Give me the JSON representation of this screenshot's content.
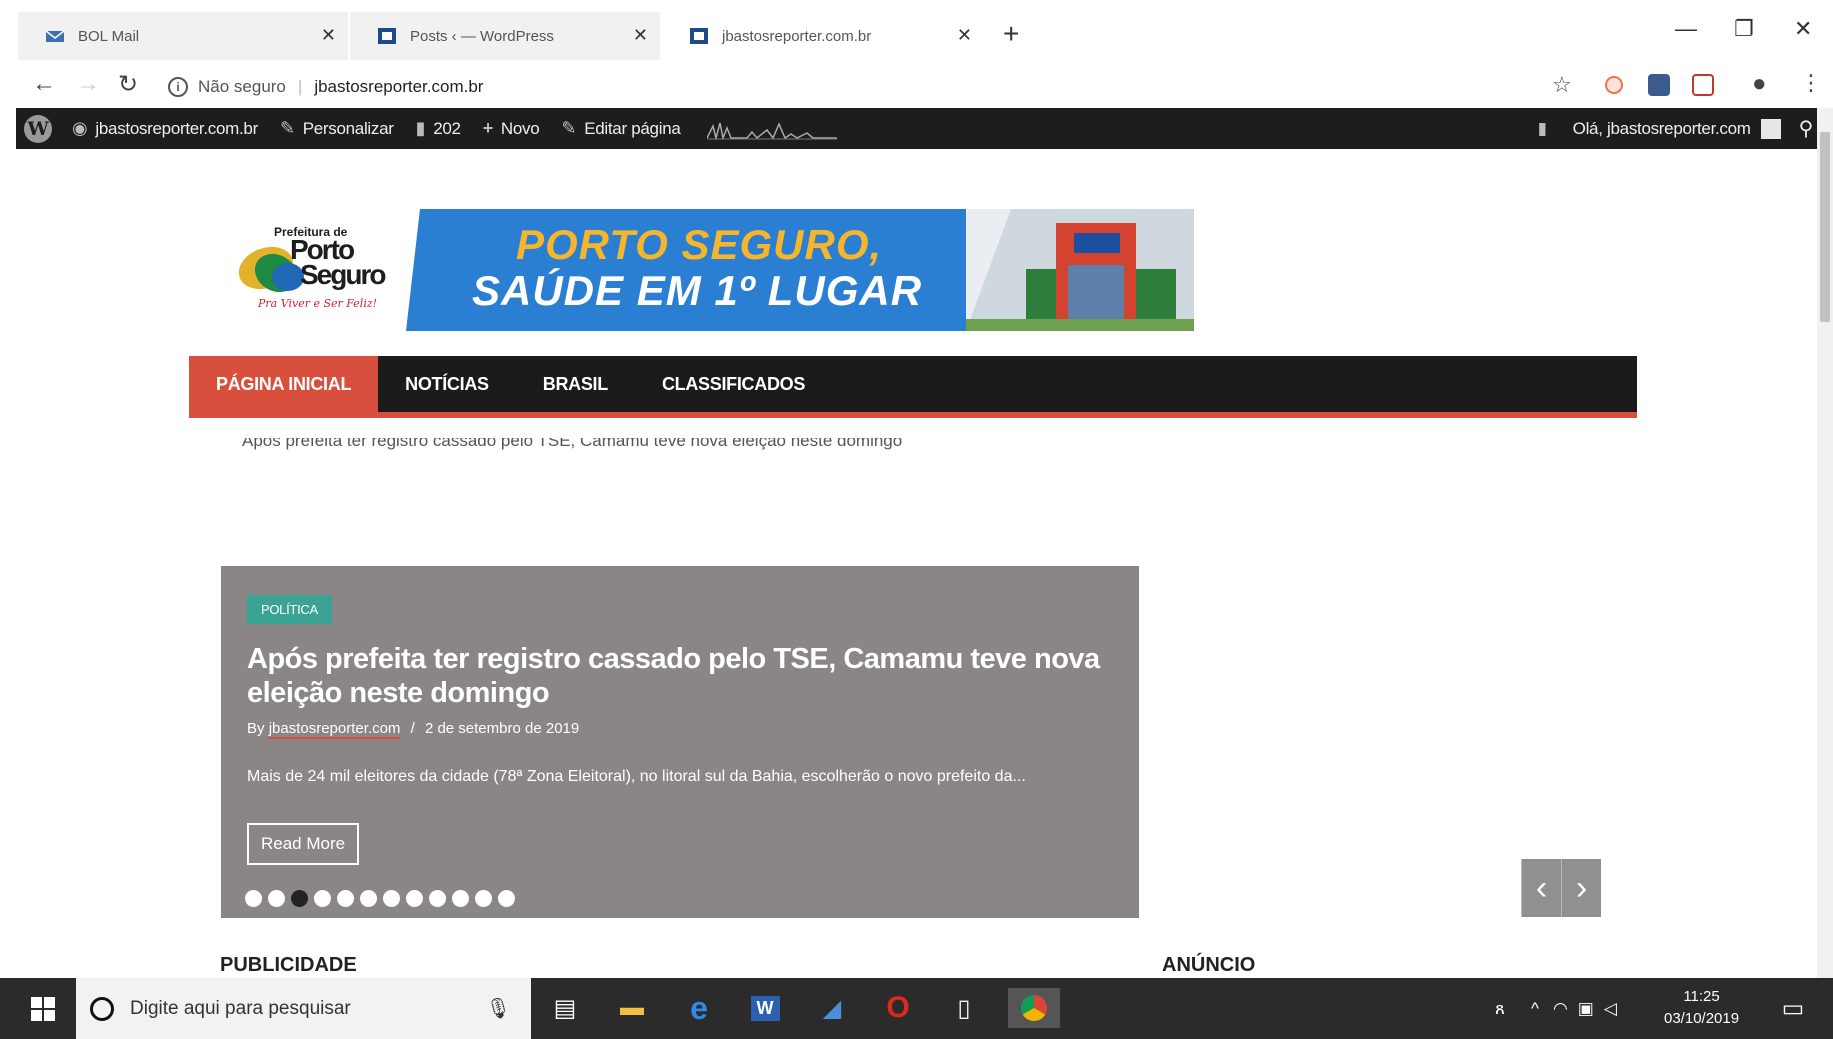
{
  "browser": {
    "tabs": [
      {
        "label": "BOL Mail"
      },
      {
        "label": "Posts ‹ — WordPress"
      },
      {
        "label": "jbastosreporter.com.br"
      }
    ],
    "security": "Não seguro",
    "url": "jbastosreporter.com.br"
  },
  "adminbar": {
    "site": "jbastosreporter.com.br",
    "customize": "Personalizar",
    "comments": "202",
    "new": "Novo",
    "edit": "Editar página",
    "greeting": "Olá, jbastosreporter.com"
  },
  "site": {
    "logo": {
      "small": "Prefeitura de",
      "line1": "Porto",
      "line2": "Seguro",
      "tagline": "Pra Viver e Ser Feliz!"
    },
    "ad": {
      "line1": "PORTO SEGURO,",
      "line2": "SAÚDE EM 1º LUGAR"
    },
    "nav": [
      {
        "label": "PÁGINA INICIAL"
      },
      {
        "label": "NOTÍCIAS"
      },
      {
        "label": "BRASIL"
      },
      {
        "label": "CLASSIFICADOS"
      }
    ],
    "ticker": "Após prefeita ter registro cassado pelo TSE, Camamu teve nova eleição neste domingo",
    "slide": {
      "category": "POLÍTICA",
      "title": "Após prefeita ter registro cassado pelo TSE, Camamu teve nova eleição neste domingo",
      "by": "By",
      "author": "jbastosreporter.com",
      "separator": "/",
      "date": "2 de setembro de 2019",
      "excerpt": "Mais de 24 mil eleitores da cidade (78ª Zona Eleitoral), no litoral sul da Bahia, escolherão o novo prefeito da...",
      "readmore": "Read More"
    },
    "publicidade": "PUBLICIDADE",
    "anuncio": "ANÚNCIO"
  },
  "taskbar": {
    "search_placeholder": "Digite aqui para pesquisar",
    "time": "11:25",
    "date": "03/10/2019"
  },
  "colors": {
    "accent": "#d94f3d",
    "category": "#3aa394",
    "adminbar": "#1d1d1d",
    "adblue": "#2a7fd3",
    "adyellow": "#f6b52a"
  }
}
